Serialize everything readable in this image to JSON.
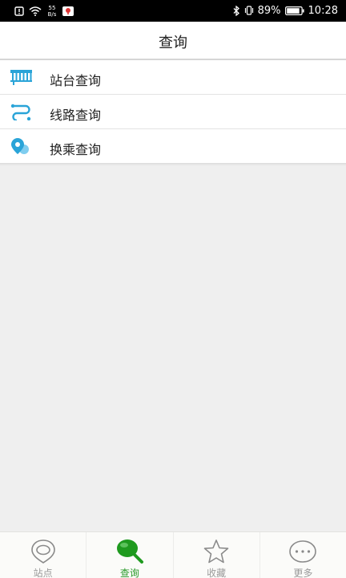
{
  "status_bar": {
    "net_speed_value": "55",
    "net_speed_unit": "B/s",
    "battery": "89%",
    "time": "10:28"
  },
  "header": {
    "title": "查询"
  },
  "menu": {
    "items": [
      {
        "label": "站台查询",
        "icon": "station-board-icon"
      },
      {
        "label": "线路查询",
        "icon": "route-icon"
      },
      {
        "label": "换乘查询",
        "icon": "transfer-pin-icon"
      }
    ]
  },
  "tabbar": {
    "tabs": [
      {
        "label": "站点",
        "icon": "location-pin-icon",
        "active": false
      },
      {
        "label": "查询",
        "icon": "search-icon",
        "active": true
      },
      {
        "label": "收藏",
        "icon": "star-icon",
        "active": false
      },
      {
        "label": "更多",
        "icon": "more-dots-icon",
        "active": false
      }
    ]
  },
  "colors": {
    "accent_green": "#2a9a2a",
    "icon_blue": "#2aa4d8",
    "background": "#efefef"
  }
}
